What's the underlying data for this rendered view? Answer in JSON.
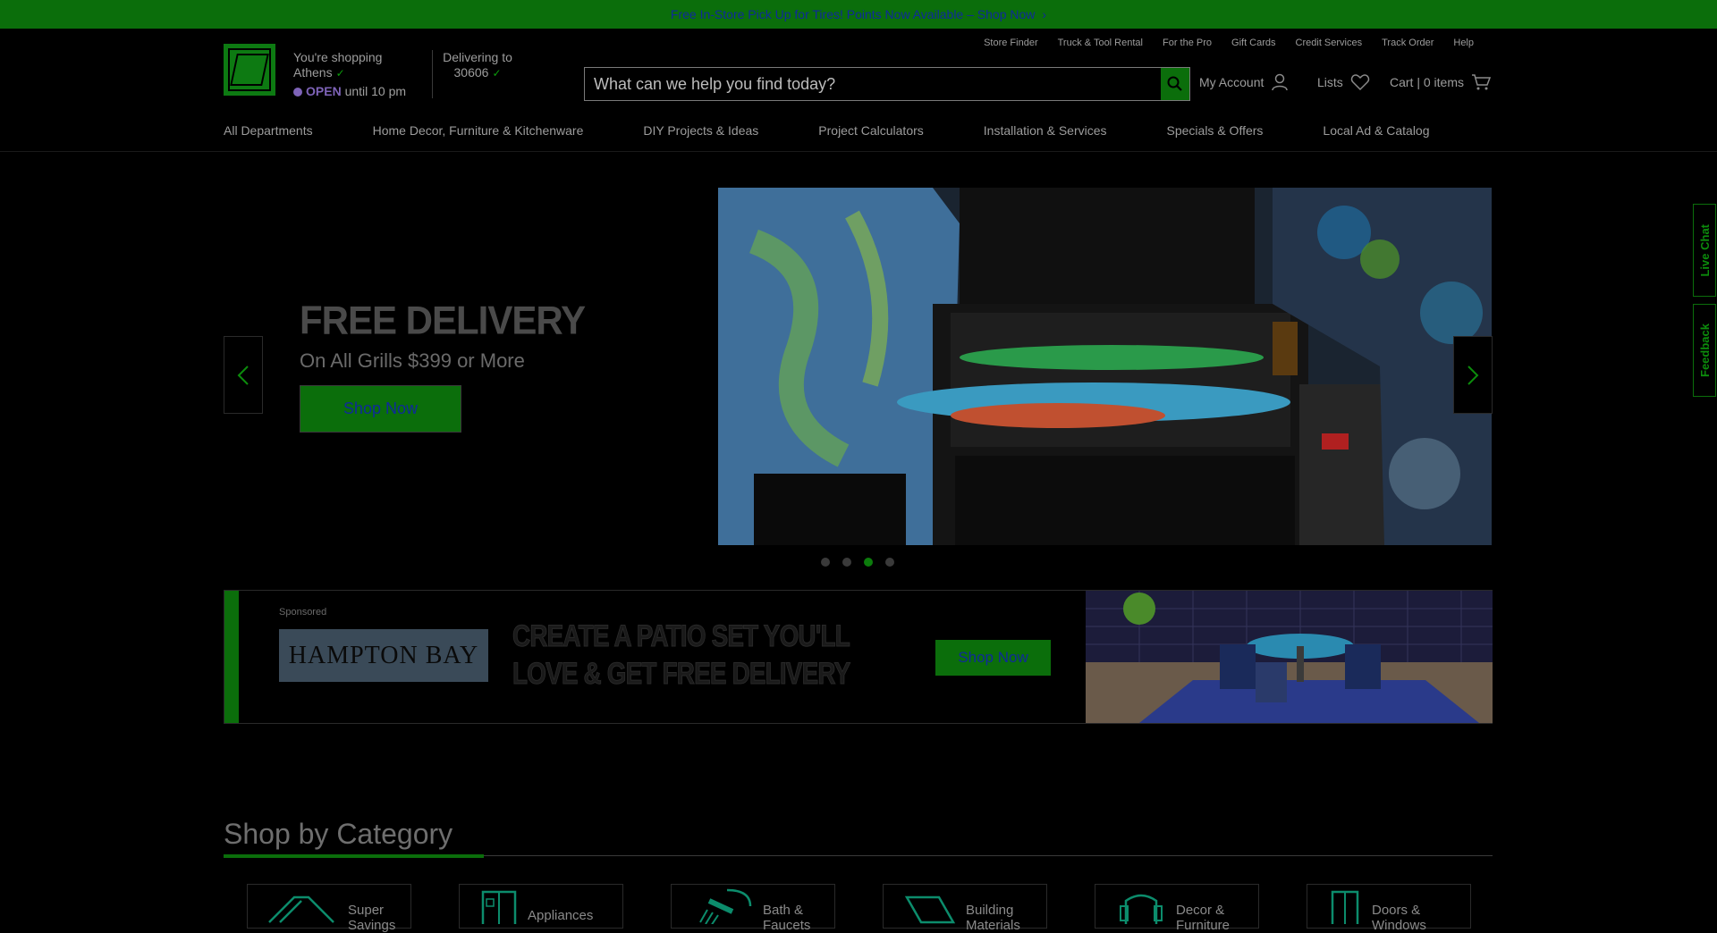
{
  "promo": {
    "text": "Free In-Store Pick Up for Tires! Points Now Available – Shop Now",
    "chevron": "›"
  },
  "store": {
    "line1": "You're shopping",
    "city": "Athens",
    "open_word": "OPEN",
    "open_rest": "until 10 pm"
  },
  "delivery": {
    "label": "Delivering to",
    "zip": "30606"
  },
  "top_links": [
    "Store Finder",
    "Truck & Tool Rental",
    "For the Pro",
    "Gift Cards",
    "Credit Services",
    "Track Order",
    "Help"
  ],
  "search": {
    "placeholder": "What can we help you find today?"
  },
  "account": {
    "my_account": "My Account",
    "lists": "Lists",
    "cart": "Cart | 0 items"
  },
  "nav": [
    "All Departments",
    "Home Decor, Furniture & Kitchenware",
    "DIY Projects & Ideas",
    "Project Calculators",
    "Installation & Services",
    "Specials & Offers",
    "Local Ad & Catalog"
  ],
  "hero": {
    "title": "FREE DELIVERY",
    "subtitle": "On All Grills $399 or More",
    "button": "Shop Now"
  },
  "sponsored": {
    "label": "Sponsored",
    "brand": "HAMPTON BAY",
    "headline_1": "CREATE A PATIO SET YOU'LL",
    "headline_2": "LOVE & GET FREE DELIVERY",
    "button": "Shop Now"
  },
  "category": {
    "title": "Shop by Category",
    "items": [
      {
        "label_1": "Super",
        "label_2": "Savings"
      },
      {
        "label_1": "Appliances",
        "label_2": ""
      },
      {
        "label_1": "Bath &",
        "label_2": "Faucets"
      },
      {
        "label_1": "Building",
        "label_2": "Materials"
      },
      {
        "label_1": "Decor &",
        "label_2": "Furniture"
      },
      {
        "label_1": "Doors &",
        "label_2": "Windows"
      }
    ]
  },
  "side_tabs": {
    "live_chat": "Live Chat",
    "feedback": "Feedback"
  },
  "icons": [
    "logo-icon",
    "chevron-down-icon",
    "search-icon",
    "user-icon",
    "heart-icon",
    "cart-icon",
    "chevron-left-icon",
    "chevron-right-icon",
    "chat-icon",
    "feedback-icon"
  ],
  "colors": {
    "brand_green": "#0b6e0b",
    "link_blue": "#0f2a9a",
    "open_purple": "#7e63b8"
  },
  "carousel": {
    "slides": 4,
    "active": 3
  }
}
